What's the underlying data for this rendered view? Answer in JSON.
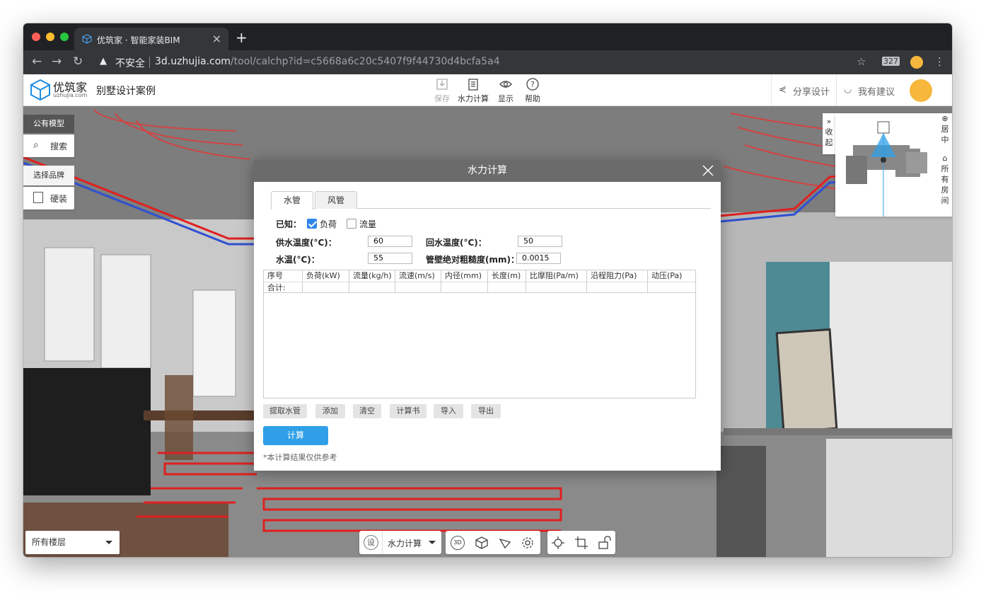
{
  "browser": {
    "tab_title": "优筑家 · 智能家装BIM",
    "insecure_label": "不安全",
    "url_host": "3d.uzhujia.com",
    "url_path": "/tool/calchp?id=c5668a6c20c5407f9f44730d4bcfa5a4"
  },
  "app": {
    "logo_cn": "优筑家",
    "logo_en": "uzhujia.com",
    "project_title": "别墅设计案例",
    "toolbar": {
      "save": "保存",
      "hydraulic": "水力计算",
      "display": "显示",
      "help": "帮助"
    },
    "share": "分享设计",
    "suggest": "我有建议"
  },
  "left_panel": {
    "public_model": "公有模型",
    "search": "搜索",
    "choose_brand": "选择品牌",
    "hard_decor": "硬装"
  },
  "right_panel": {
    "collapse": "收起",
    "center": "居中",
    "all_rooms": "所有房间"
  },
  "bottom": {
    "floor_select": "所有楼层",
    "settings_badge": "设",
    "mode_select": "水力计算",
    "view_3d": "3D"
  },
  "dialog": {
    "title": "水力计算",
    "tabs": [
      "水管",
      "风管"
    ],
    "known_label": "已知：",
    "opt_load": "负荷",
    "opt_flow": "流量",
    "supply_temp_label": "供水温度(°C)：",
    "supply_temp": "60",
    "return_temp_label": "回水温度(°C)：",
    "return_temp": "50",
    "water_temp_label": "水温(°C)：",
    "water_temp": "55",
    "roughness_label": "管壁绝对粗糙度(mm)：",
    "roughness": "0.0015",
    "table_headers": [
      "序号",
      "负荷(kW)",
      "流量(kg/h)",
      "流速(m/s)",
      "内径(mm)",
      "长度(m)",
      "比摩阻(Pa/m)",
      "沿程阻力(Pa)",
      "动压(Pa)"
    ],
    "total_label": "合计:",
    "actions": [
      "提取水管",
      "添加",
      "清空",
      "计算书",
      "导入",
      "导出"
    ],
    "calc_button": "计算",
    "note": "*本计算结果仅供参考"
  },
  "colors": {
    "accent": "#2fa0e8",
    "checkbox": "#2f86e8",
    "dialog_header": "#6b6b6b",
    "heating_pipe": "#e23a3a"
  }
}
